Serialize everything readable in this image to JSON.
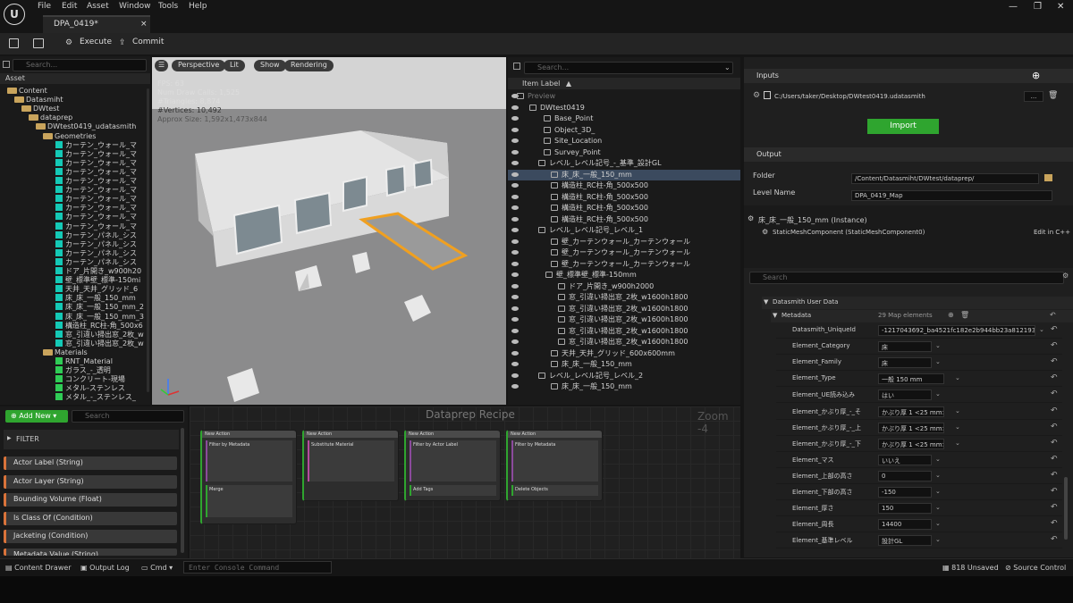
{
  "menu": {
    "items": [
      "File",
      "Edit",
      "Asset",
      "Window",
      "Tools",
      "Help"
    ]
  },
  "tab": {
    "title": "DPA_0419*",
    "close": "×"
  },
  "toolbar": {
    "execute": "Execute",
    "commit": "Commit"
  },
  "assets": {
    "search_placeholder": "Search...",
    "header": "Asset",
    "tree": [
      {
        "label": "Content",
        "kind": "folder",
        "indent": 8
      },
      {
        "label": "Datasmiht",
        "kind": "folder",
        "indent": 16
      },
      {
        "label": "DWtest",
        "kind": "folder",
        "indent": 24
      },
      {
        "label": "dataprep",
        "kind": "folder",
        "indent": 32
      },
      {
        "label": "DWtest0419_udatasmith",
        "kind": "folder",
        "indent": 40
      },
      {
        "label": "Geometries",
        "kind": "folder",
        "indent": 48
      },
      {
        "label": "カーテン_ウォール_マ",
        "kind": "mesh",
        "indent": 62
      },
      {
        "label": "カーテン_ウォール_マ",
        "kind": "mesh",
        "indent": 62
      },
      {
        "label": "カーテン_ウォール_マ",
        "kind": "mesh",
        "indent": 62
      },
      {
        "label": "カーテン_ウォール_マ",
        "kind": "mesh",
        "indent": 62
      },
      {
        "label": "カーテン_ウォール_マ",
        "kind": "mesh",
        "indent": 62
      },
      {
        "label": "カーテン_ウォール_マ",
        "kind": "mesh",
        "indent": 62
      },
      {
        "label": "カーテン_ウォール_マ",
        "kind": "mesh",
        "indent": 62
      },
      {
        "label": "カーテン_ウォール_マ",
        "kind": "mesh",
        "indent": 62
      },
      {
        "label": "カーテン_ウォール_マ",
        "kind": "mesh",
        "indent": 62
      },
      {
        "label": "カーテン_ウォール_マ",
        "kind": "mesh",
        "indent": 62
      },
      {
        "label": "カーテン_パネル_シス",
        "kind": "mesh",
        "indent": 62
      },
      {
        "label": "カーテン_パネル_シス",
        "kind": "mesh",
        "indent": 62
      },
      {
        "label": "カーテン_パネル_シス",
        "kind": "mesh",
        "indent": 62
      },
      {
        "label": "カーテン_パネル_シス",
        "kind": "mesh",
        "indent": 62
      },
      {
        "label": "ドア_片開き_w900h20",
        "kind": "mesh",
        "indent": 62
      },
      {
        "label": "壁_標準壁_標準-150mi",
        "kind": "mesh",
        "indent": 62
      },
      {
        "label": "天井_天井_グリッド_6",
        "kind": "mesh",
        "indent": 62
      },
      {
        "label": "床_床_一般_150_mm",
        "kind": "mesh",
        "indent": 62
      },
      {
        "label": "床_床_一般_150_mm_2",
        "kind": "mesh",
        "indent": 62
      },
      {
        "label": "床_床_一般_150_mm_3",
        "kind": "mesh",
        "indent": 62
      },
      {
        "label": "構造柱_RC柱-角_500x6",
        "kind": "mesh",
        "indent": 62
      },
      {
        "label": "窓_引違い掃出窓_2枚_w",
        "kind": "mesh",
        "indent": 62
      },
      {
        "label": "窓_引違い掃出窓_2枚_w",
        "kind": "mesh",
        "indent": 62
      },
      {
        "label": "Materials",
        "kind": "folder",
        "indent": 48
      },
      {
        "label": "RNT_Material",
        "kind": "mat",
        "indent": 62
      },
      {
        "label": "ガラス_-_透明",
        "kind": "mat",
        "indent": 62
      },
      {
        "label": "コンクリート-現場",
        "kind": "mat",
        "indent": 62
      },
      {
        "label": "メタル-ステンレス",
        "kind": "mat",
        "indent": 62
      },
      {
        "label": "メタル_-_ステンレス_",
        "kind": "mat",
        "indent": 62
      }
    ]
  },
  "viewport": {
    "buttons": [
      "Perspective",
      "Lit",
      "Show",
      "Rendering"
    ],
    "stats": [
      "FPS:  63",
      "Num Draw Calls:  1,525",
      "#Triangles:  8,874",
      "#Vertices:  10,492",
      "Approx Size:  1,592x1,473x844"
    ]
  },
  "outliner": {
    "search_placeholder": "Search...",
    "header": "Item Label",
    "rows": [
      {
        "label": "Preview",
        "indent": 10,
        "dim": true
      },
      {
        "label": "DWtest0419",
        "indent": 24
      },
      {
        "label": "Base_Point",
        "indent": 40
      },
      {
        "label": "Object_3D_",
        "indent": 40
      },
      {
        "label": "Site_Location",
        "indent": 40
      },
      {
        "label": "Survey_Point",
        "indent": 40
      },
      {
        "label": "レベル_レベル記号_-_基準_設計GL",
        "indent": 34
      },
      {
        "label": "床_床_一般_150_mm",
        "indent": 48,
        "selected": true
      },
      {
        "label": "構造柱_RC柱-角_500x500",
        "indent": 48
      },
      {
        "label": "構造柱_RC柱-角_500x500",
        "indent": 48
      },
      {
        "label": "構造柱_RC柱-角_500x500",
        "indent": 48
      },
      {
        "label": "構造柱_RC柱-角_500x500",
        "indent": 48
      },
      {
        "label": "レベル_レベル記号_レベル_1",
        "indent": 34
      },
      {
        "label": "壁_カーテンウォール_カーテンウォール",
        "indent": 48
      },
      {
        "label": "壁_カーテンウォール_カーテンウォール",
        "indent": 48
      },
      {
        "label": "壁_カーテンウォール_カーテンウォール",
        "indent": 48
      },
      {
        "label": "壁_標準壁_標準-150mm",
        "indent": 42
      },
      {
        "label": "ドア_片開き_w900h2000",
        "indent": 56
      },
      {
        "label": "窓_引違い掃出窓_2枚_w1600h1800",
        "indent": 56
      },
      {
        "label": "窓_引違い掃出窓_2枚_w1600h1800",
        "indent": 56
      },
      {
        "label": "窓_引違い掃出窓_2枚_w1600h1800",
        "indent": 56
      },
      {
        "label": "窓_引違い掃出窓_2枚_w1600h1800",
        "indent": 56
      },
      {
        "label": "窓_引違い掃出窓_2枚_w1600h1800",
        "indent": 56
      },
      {
        "label": "天井_天井_グリッド_600x600mm",
        "indent": 48
      },
      {
        "label": "床_床_一般_150_mm",
        "indent": 48
      },
      {
        "label": "レベル_レベル記号_レベル_2",
        "indent": 34
      },
      {
        "label": "床_床_一般_150_mm",
        "indent": 48
      }
    ]
  },
  "details": {
    "inputs_title": "Inputs",
    "input_path": "C:/Users/taker/Desktop/DWtest0419.udatasmith",
    "browse": "...",
    "import_label": "Import",
    "output_title": "Output",
    "folder_label": "Folder",
    "folder_value": "/Content/Datasmiht/DWtest/dataprep/",
    "level_label": "Level Name",
    "level_value": "DPA_0419_Map",
    "instance_title": "床_床_一般_150_mm (Instance)",
    "component": "StaticMeshComponent (StaticMeshComponent0)",
    "edit_cpp": "Edit in C++",
    "search_placeholder": "Search",
    "user_data": "Datasmith User Data",
    "metadata": "Metadata",
    "map_count": "29 Map elements",
    "rows": [
      {
        "key": "Datasmith_UniqueId",
        "value": "-1217043692_ba4521fc182e2b944bb23a812193?f"
      },
      {
        "key": "Element_Category",
        "value": "床"
      },
      {
        "key": "Element_Family",
        "value": "床"
      },
      {
        "key": "Element_Type",
        "value": "一般 150 mm"
      },
      {
        "key": "Element_UE読み込み",
        "value": "はい"
      },
      {
        "key": "Element_かぶり厚_-_そ",
        "value": "かぶり厚 1 <25 mm>"
      },
      {
        "key": "Element_かぶり厚_-_上",
        "value": "かぶり厚 1 <25 mm>"
      },
      {
        "key": "Element_かぶり厚_-_下",
        "value": "かぶり厚 1 <25 mm>"
      },
      {
        "key": "Element_マス",
        "value": "いいえ"
      },
      {
        "key": "Element_上部の高さ",
        "value": "0"
      },
      {
        "key": "Element_下部の高さ",
        "value": "-150"
      },
      {
        "key": "Element_厚さ",
        "value": "150"
      },
      {
        "key": "Element_周長",
        "value": "14400"
      },
      {
        "key": "Element_基準レベル",
        "value": "設計GL"
      }
    ]
  },
  "filter": {
    "add_new": "Add New",
    "search_placeholder": "Search",
    "title": "FILTER",
    "items": [
      "Actor Label (String)",
      "Actor Layer (String)",
      "Bounding Volume (Float)",
      "Is Class Of (Condition)",
      "Jacketing (Condition)",
      "Metadata Value (String)"
    ]
  },
  "recipe": {
    "title": "Dataprep Recipe",
    "zoom": "Zoom -4",
    "nodes": [
      {
        "header": "New Action",
        "title": "Filter by Metadata",
        "sub1": "Merge"
      },
      {
        "header": "New Action",
        "title": "Substitute Material",
        "sub1": ""
      },
      {
        "header": "New Action",
        "title": "Filter by Actor Label",
        "sub1": "Add Tags"
      },
      {
        "header": "New Action",
        "title": "Filter by Metadata",
        "sub1": "Delete Objects"
      }
    ]
  },
  "status": {
    "content_drawer": "Content Drawer",
    "output_log": "Output Log",
    "cmd": "Cmd",
    "console_placeholder": "Enter Console Command",
    "unsaved": "818 Unsaved",
    "source_control": "Source Control"
  }
}
